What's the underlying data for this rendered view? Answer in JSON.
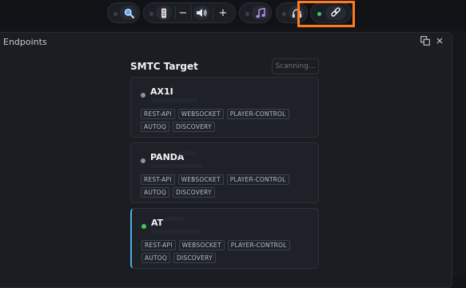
{
  "toolbar": {
    "icons": {
      "search": "search-icon",
      "remote": "remote-icon",
      "volume": "speaker-icon",
      "music": "music-note-icon",
      "headphones": "headphones-icon",
      "link": "link-icon"
    },
    "volume_down_label": "−",
    "volume_up_label": "+",
    "highlight_color": "#ff7a1a",
    "connected_color": "#41c464"
  },
  "panel": {
    "title": "Endpoints",
    "icons": {
      "popout": "popout-icon",
      "close": "close-icon"
    }
  },
  "smtc": {
    "title": "SMTC Target",
    "scan_button": "Scanning..."
  },
  "endpoints": [
    {
      "name": "AX1I",
      "online": false,
      "active": false,
      "tags": [
        "REST-API",
        "WEBSOCKET",
        "PLAYER-CONTROL",
        "AUTOQ",
        "DISCOVERY"
      ]
    },
    {
      "name": "PANDA",
      "online": false,
      "active": false,
      "tags": [
        "REST-API",
        "WEBSOCKET",
        "PLAYER-CONTROL",
        "AUTOQ",
        "DISCOVERY"
      ]
    },
    {
      "name": "AT",
      "online": true,
      "active": true,
      "tags": [
        "REST-API",
        "WEBSOCKET",
        "PLAYER-CONTROL",
        "AUTOQ",
        "DISCOVERY"
      ]
    }
  ]
}
